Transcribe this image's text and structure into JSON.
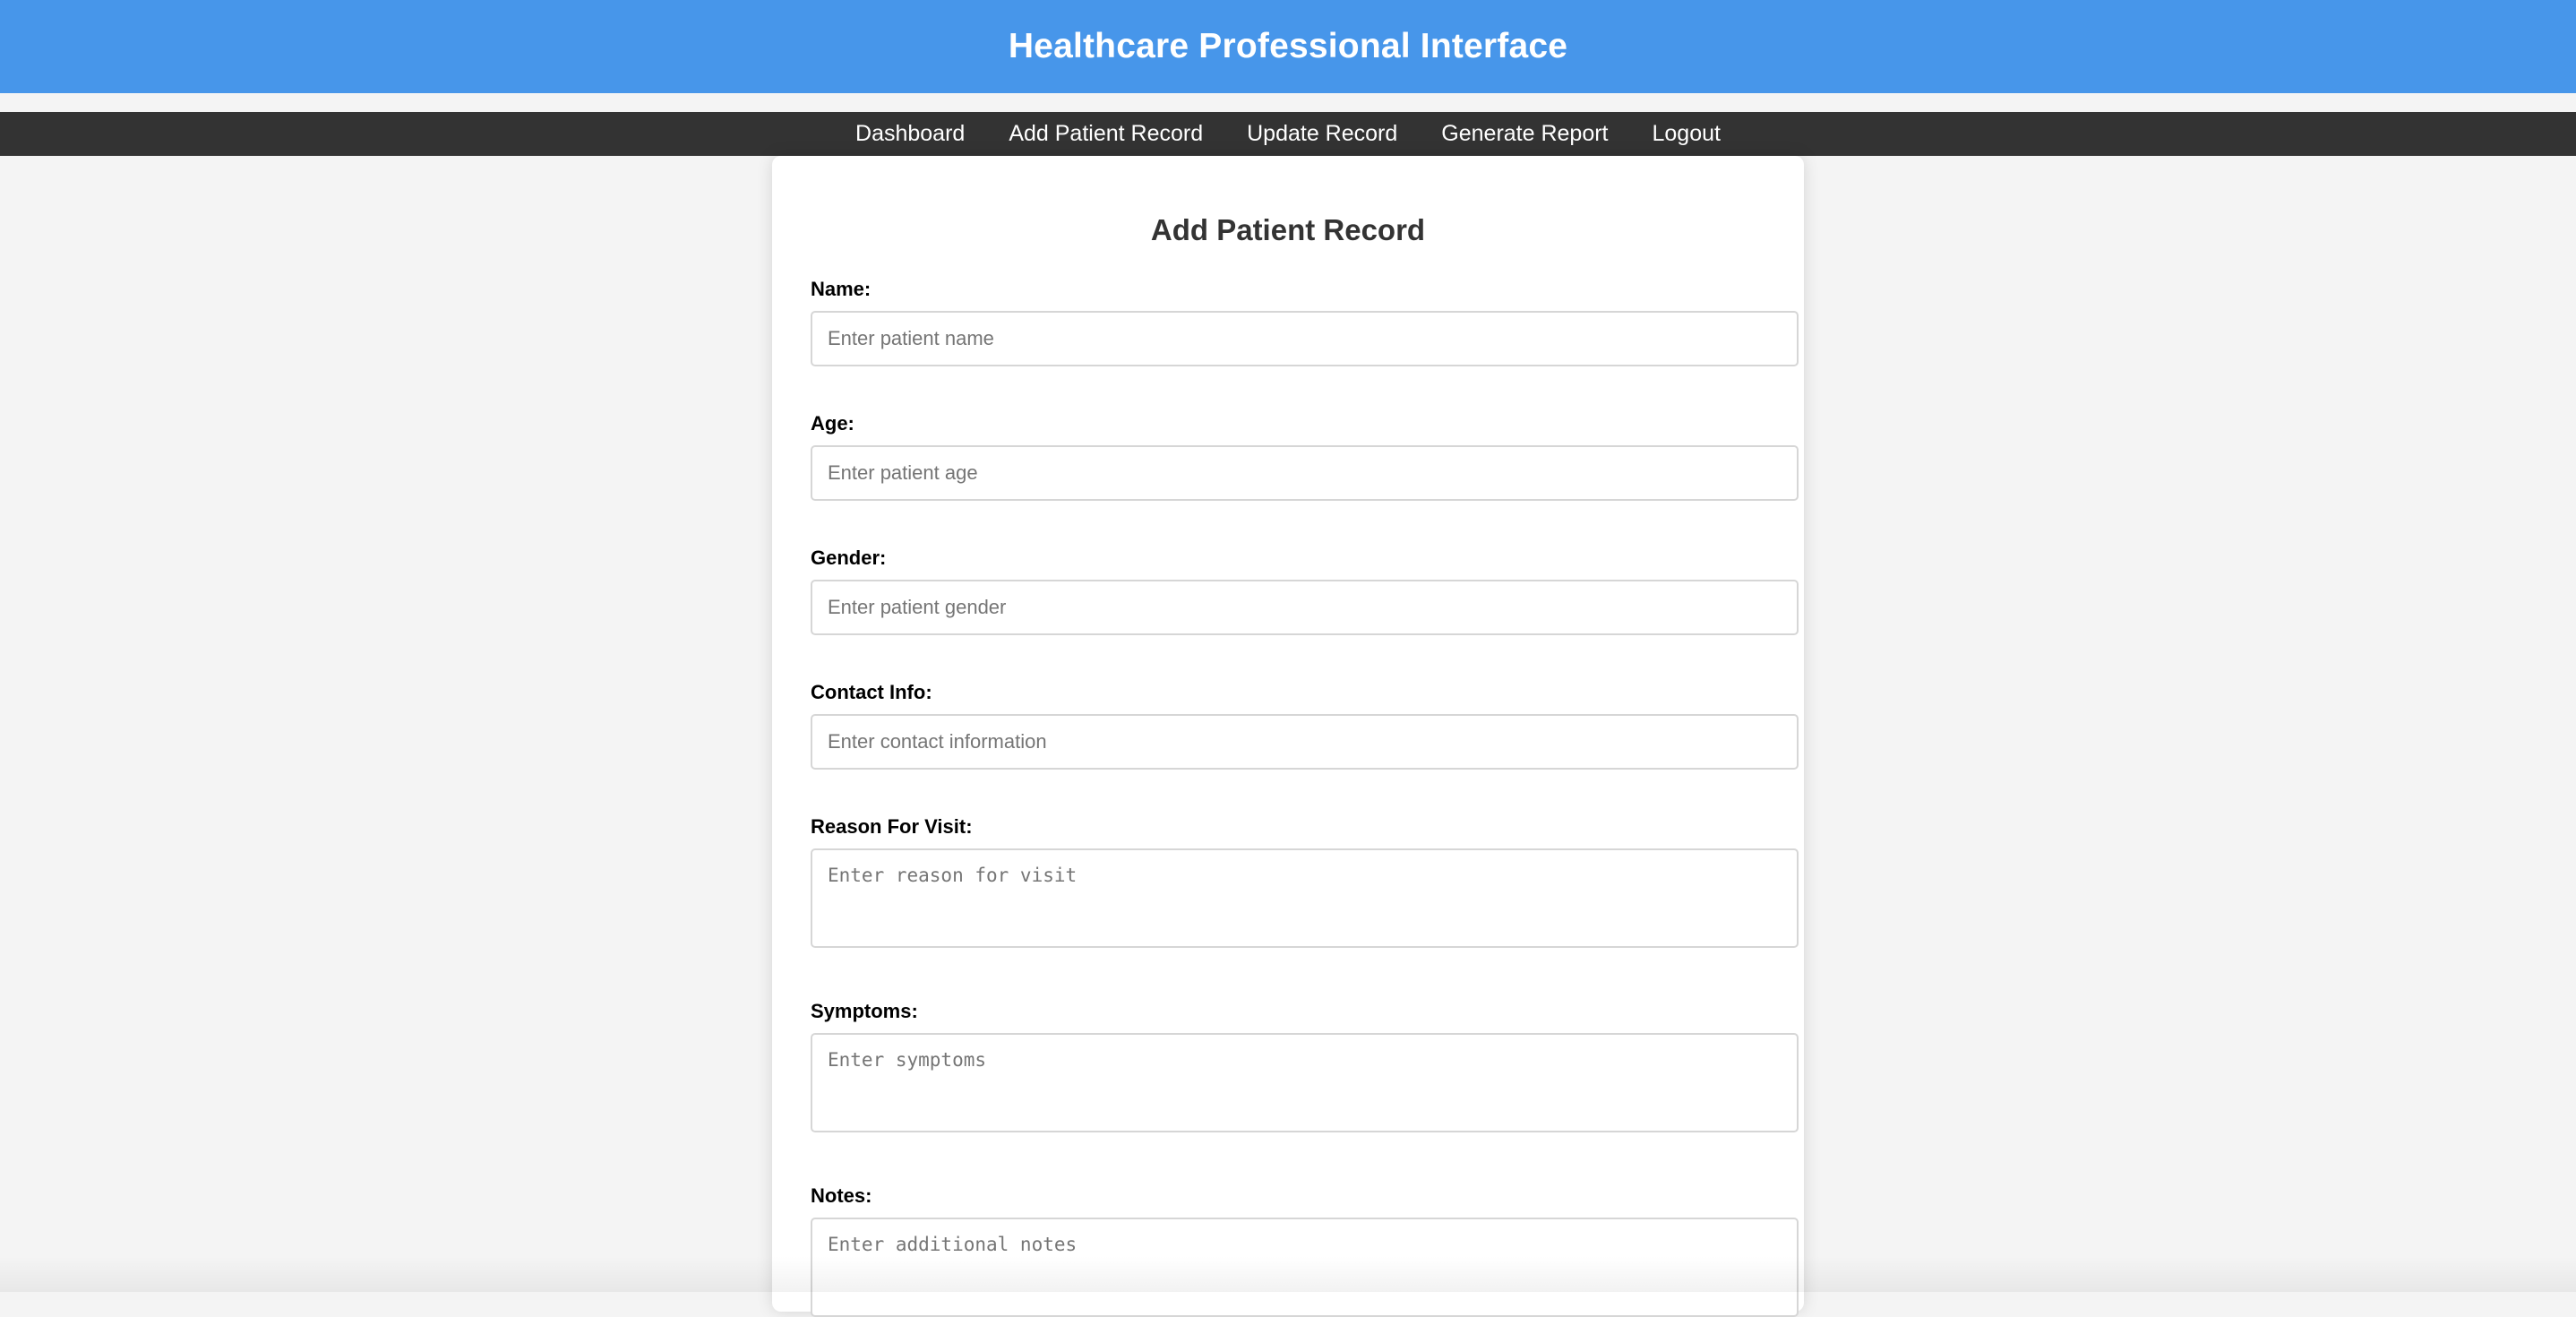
{
  "header": {
    "title": "Healthcare Professional Interface"
  },
  "nav": {
    "items": [
      {
        "label": "Dashboard"
      },
      {
        "label": "Add Patient Record"
      },
      {
        "label": "Update Record"
      },
      {
        "label": "Generate Report"
      },
      {
        "label": "Logout"
      }
    ]
  },
  "form": {
    "title": "Add Patient Record",
    "fields": [
      {
        "label": "Name:",
        "placeholder": "Enter patient name",
        "value": ""
      },
      {
        "label": "Age:",
        "placeholder": "Enter patient age",
        "value": ""
      },
      {
        "label": "Gender:",
        "placeholder": "Enter patient gender",
        "value": ""
      },
      {
        "label": "Contact Info:",
        "placeholder": "Enter contact information",
        "value": ""
      },
      {
        "label": "Reason For Visit:",
        "placeholder": "Enter reason for visit",
        "value": ""
      },
      {
        "label": "Symptoms:",
        "placeholder": "Enter symptoms",
        "value": ""
      },
      {
        "label": "Notes:",
        "placeholder": "Enter additional notes",
        "value": ""
      }
    ]
  },
  "colors": {
    "header_bg": "#4796ea",
    "nav_bg": "#333333",
    "page_bg": "#f4f4f4",
    "card_bg": "#ffffff"
  }
}
